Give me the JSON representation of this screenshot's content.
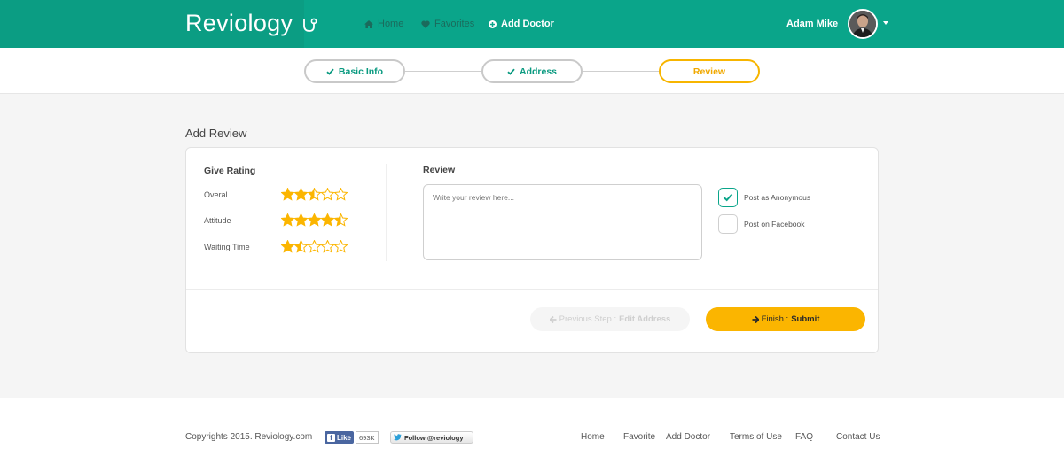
{
  "brand": {
    "name": "Reviology",
    "accent": "#0aa58a",
    "highlight": "#fbb500"
  },
  "nav": {
    "items": [
      {
        "label": "Home",
        "icon": "home-icon"
      },
      {
        "label": "Favorites",
        "icon": "heart-icon"
      },
      {
        "label": "Add Doctor",
        "icon": "plus-circle-icon"
      }
    ]
  },
  "user": {
    "name": "Adam Mike"
  },
  "stepper": {
    "steps": [
      {
        "label": "Basic Info",
        "status": "done"
      },
      {
        "label": "Address",
        "status": "done"
      },
      {
        "label": "Review",
        "status": "current"
      }
    ]
  },
  "page": {
    "title": "Add Review"
  },
  "rating": {
    "heading": "Give Rating",
    "max": 5,
    "items": [
      {
        "label": "Overal",
        "value": 2.5
      },
      {
        "label": "Attitude",
        "value": 4.5
      },
      {
        "label": "Waiting Time",
        "value": 1.5
      }
    ]
  },
  "review": {
    "heading": "Review",
    "placeholder": "Write your review here..."
  },
  "options": [
    {
      "label": "Post as Anonymous",
      "checked": true
    },
    {
      "label": "Post on Facebook",
      "checked": false
    }
  ],
  "actions": {
    "prev_prefix": "Previous Step : ",
    "prev_label": "Edit Address",
    "submit_prefix": "Finish : ",
    "submit_label": "Submit"
  },
  "footer": {
    "copyright": "Copyrights 2015. Reviology.com",
    "fb_like": "Like",
    "fb_count": "693K",
    "tw_follow": "Follow @reviology",
    "links": [
      "Home",
      "Favorite",
      "Add Doctor",
      "Terms of Use",
      "FAQ",
      "Contact Us"
    ]
  }
}
